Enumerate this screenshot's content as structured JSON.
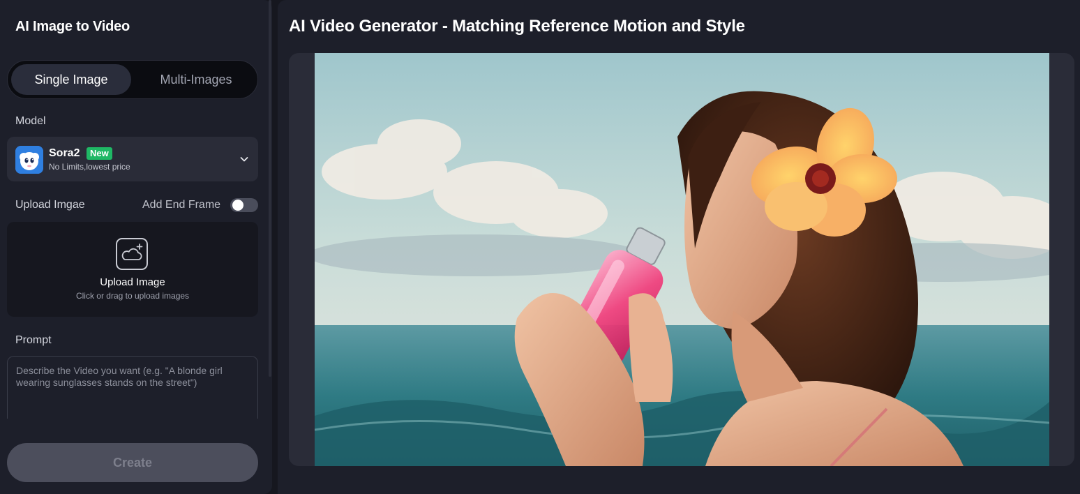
{
  "left_panel": {
    "title": "AI Image to Video",
    "tabs": [
      {
        "label": "Single Image",
        "active": true
      },
      {
        "label": "Multi-Images",
        "active": false
      }
    ],
    "model_label": "Model",
    "model": {
      "name": "Sora2",
      "badge": "New",
      "subtitle": "No Limits,lowest price",
      "icon": "chevron-down-icon"
    },
    "upload_label": "Upload Imgae",
    "end_frame": {
      "label": "Add End Frame",
      "enabled": false
    },
    "upload": {
      "icon": "upload-image-icon",
      "title": "Upload Image",
      "subtitle": "Click or drag to upload images"
    },
    "prompt_label": "Prompt",
    "prompt_placeholder": "Describe the Video you want (e.g. \"A blonde girl wearing sunglasses stands on the street\")",
    "create_label": "Create"
  },
  "main": {
    "title": "AI Video Generator - Matching Reference Motion and Style",
    "preview": {
      "kind": "video-preview"
    }
  },
  "colors": {
    "background": "#16171f",
    "panel": "#1d1f2a",
    "card": "#2a2c38",
    "badge_green": "#1fb865",
    "create_disabled": "#4c4e5c"
  }
}
